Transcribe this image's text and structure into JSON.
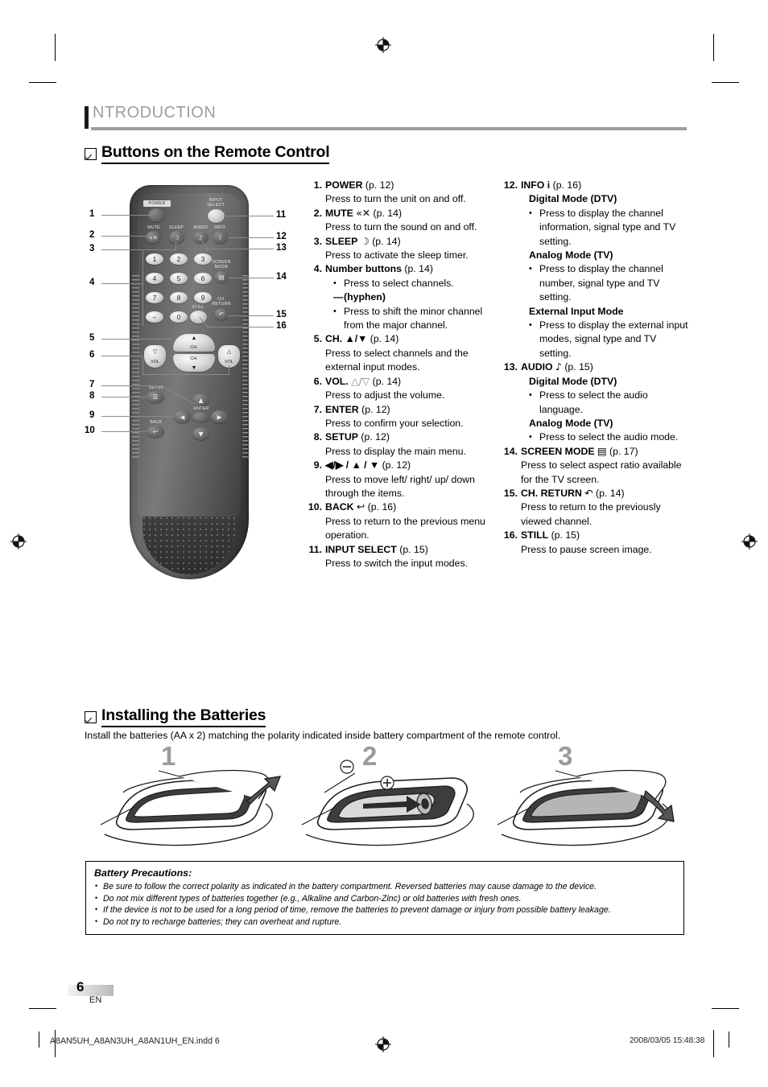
{
  "page": {
    "chapter_title": "NTRODUCTION",
    "page_number": "6",
    "page_language": "EN"
  },
  "sections": {
    "remote": {
      "heading": "Buttons on the Remote Control"
    },
    "batteries": {
      "heading": "Installing the Batteries",
      "intro": "Install the batteries (AA x 2) matching the polarity indicated inside battery compartment of the remote control.",
      "steps": [
        {
          "number": "1"
        },
        {
          "number": "2",
          "minus": "⊖",
          "plus": "⊕"
        },
        {
          "number": "3"
        }
      ]
    }
  },
  "remote_figure": {
    "labels": {
      "power": "POWER",
      "input_select_1": "INPUT",
      "input_select_2": "SELECT",
      "mute": "MUTE",
      "sleep": "SLEEP",
      "audio": "AUDIO",
      "info": "INFO",
      "screen_mode_1": "SCREEN",
      "screen_mode_2": "MODE",
      "ch_return_1": "CH.",
      "ch_return_2": "RETURN",
      "still": "STILL",
      "setup": "SETUP",
      "back": "BACK",
      "enter": "ENTER",
      "ch_up": "CH.",
      "ch_down": "CH.",
      "vol_down": "VOL",
      "vol_up": "VOL"
    },
    "glyphs": {
      "mute": "«✕",
      "sleep": "☽",
      "audio": "♪",
      "info": "i",
      "screen_mode": "▤",
      "ch_return": "↶",
      "setup": "☰",
      "back": "↩",
      "ch_up": "▲",
      "ch_down": "▼",
      "vol_up": "△",
      "vol_down": "▽",
      "nav_up": "▲",
      "nav_down": "▼",
      "nav_left": "◀",
      "nav_right": "▶"
    },
    "keypad": [
      "1",
      "2",
      "3",
      "4",
      "5",
      "6",
      "7",
      "8",
      "9",
      "–",
      "0"
    ],
    "callouts": [
      "1",
      "2",
      "3",
      "4",
      "5",
      "6",
      "7",
      "8",
      "9",
      "10",
      "11",
      "12",
      "13",
      "14",
      "15",
      "16"
    ]
  },
  "list_left": [
    {
      "num": "1.",
      "title": "POWER",
      "suffix": " (p. 12)",
      "lines": [
        "Press to turn the unit on and off."
      ]
    },
    {
      "num": "2.",
      "title": "MUTE",
      "glyph": "«✕",
      "suffix": " (p. 14)",
      "lines": [
        "Press to turn the sound on and off."
      ]
    },
    {
      "num": "3.",
      "title": "SLEEP",
      "glyph": "☽",
      "suffix": " (p. 14)",
      "lines": [
        "Press to activate the sleep timer."
      ]
    },
    {
      "num": "4.",
      "title": "Number buttons",
      "suffix": " (p. 14)",
      "bullets": [
        "Press to select channels."
      ],
      "dash": "(hyphen)",
      "bullets2": [
        "Press to shift the minor channel from the major channel."
      ]
    },
    {
      "num": "5.",
      "title": "CH. ▲/▼",
      "suffix": " (p. 14)",
      "lines": [
        "Press to select channels and the external input modes."
      ]
    },
    {
      "num": "6.",
      "title": "VOL.",
      "glyph": "△/▽",
      "suffix": " (p. 14)",
      "lines": [
        "Press to adjust the volume."
      ]
    },
    {
      "num": "7.",
      "title": "ENTER",
      "suffix": " (p. 12)",
      "lines": [
        "Press to confirm your selection."
      ]
    },
    {
      "num": "8.",
      "title": "SETUP",
      "suffix": " (p. 12)",
      "lines": [
        "Press to display the main menu."
      ]
    },
    {
      "num": "9.",
      "title": "◀/▶ / ▲ / ▼",
      "suffix": " (p. 12)",
      "lines": [
        "Press to move left/ right/ up/ down through the items."
      ]
    },
    {
      "num": "10.",
      "title": "BACK",
      "glyph": "↩",
      "suffix": " (p. 16)",
      "lines": [
        "Press to return to the previous menu operation."
      ]
    },
    {
      "num": "11.",
      "title": "INPUT SELECT",
      "suffix": " (p. 15)",
      "lines": [
        "Press to switch the input modes."
      ]
    }
  ],
  "list_right": [
    {
      "num": "12.",
      "title": "INFO i",
      "suffix": " (p. 16)",
      "groups": [
        {
          "sub": "Digital Mode (DTV)",
          "bullets": [
            "Press to display the channel information, signal type and TV setting."
          ]
        },
        {
          "sub": "Analog Mode (TV)",
          "bullets": [
            "Press to display the channel number, signal type and TV setting."
          ]
        },
        {
          "sub": "External Input Mode",
          "bullets": [
            "Press to display the external input modes, signal type and TV setting."
          ]
        }
      ]
    },
    {
      "num": "13.",
      "title": "AUDIO",
      "glyph": "♪",
      "suffix": " (p. 15)",
      "groups": [
        {
          "sub": "Digital Mode (DTV)",
          "bullets": [
            "Press to select the audio language."
          ]
        },
        {
          "sub": "Analog Mode (TV)",
          "bullets": [
            "Press to select the audio mode."
          ]
        }
      ]
    },
    {
      "num": "14.",
      "title": "SCREEN MODE",
      "glyph": "▤",
      "suffix": " (p. 17)",
      "lines": [
        "Press to select aspect ratio available for the TV screen."
      ]
    },
    {
      "num": "15.",
      "title": "CH. RETURN",
      "glyph": "↶",
      "suffix": " (p. 14)",
      "lines": [
        "Press to return to the previously viewed channel."
      ]
    },
    {
      "num": "16.",
      "title": "STILL",
      "suffix": " (p. 15)",
      "lines": [
        "Press to pause screen image."
      ]
    }
  ],
  "precautions": {
    "title": "Battery Precautions:",
    "items": [
      "Be sure to follow the correct polarity as indicated in the battery compartment. Reversed batteries may cause damage to the device.",
      "Do not mix different types of batteries together (e.g., Alkaline and Carbon-Zinc) or old batteries with fresh ones.",
      "If the device is not to be used for a long period of time, remove the batteries to prevent damage or injury from possible battery leakage.",
      "Do not try to recharge batteries; they can overheat and rupture."
    ]
  },
  "footer": {
    "file": "A8AN5UH_A8AN3UH_A8AN1UH_EN.indd   6",
    "date": "2008/03/05   15:48:38"
  }
}
